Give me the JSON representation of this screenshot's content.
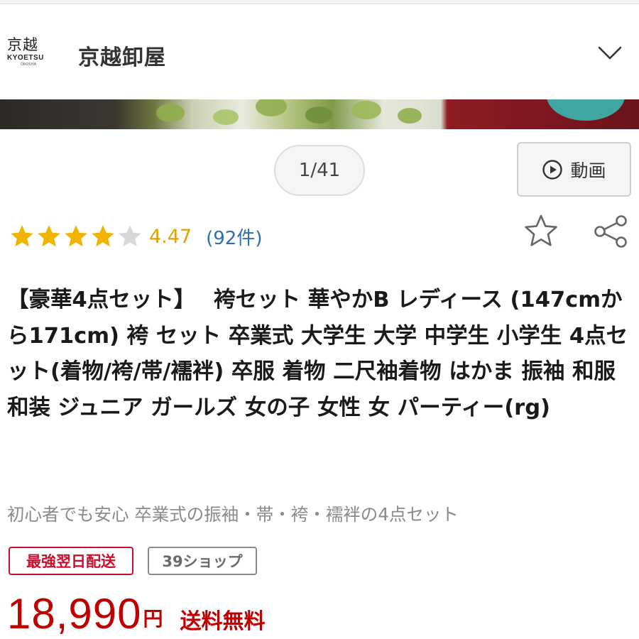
{
  "header": {
    "logo_mark": "京越",
    "logo_text": "KYOETSU",
    "logo_subtext": "OROSIYA",
    "store_name": "京越卸屋"
  },
  "gallery": {
    "pager": "1/41",
    "video_label": "動画"
  },
  "rating": {
    "stars": 4.47,
    "value": "4.47",
    "count": "(92件)",
    "star_color": "#f0b400"
  },
  "product": {
    "title": "【豪華4点セット】　 袴セット 華やかB レディース (147cmから171cm) 袴 セット 卒業式 大学生 大学 中学生 小学生 4点セット(着物/袴/帯/襦袢) 卒服 着物 二尺袖着物 はかま 振袖 和服 和装 ジュニア ガールズ 女の子 女性 女 パーティー(rg)",
    "subtitle": "初心者でも安心 卒業式の振袖・帯・袴・襦袢の4点セット"
  },
  "badges": {
    "delivery": "最強翌日配送",
    "shop": "39ショップ"
  },
  "price": {
    "amount": "18,990",
    "currency": "円",
    "shipping": "送料無料",
    "color": "#bf0000"
  },
  "icons": {
    "chevron": "chevron-down-icon",
    "play": "play-circle-icon",
    "favorite": "star-outline-icon",
    "share": "share-icon"
  }
}
